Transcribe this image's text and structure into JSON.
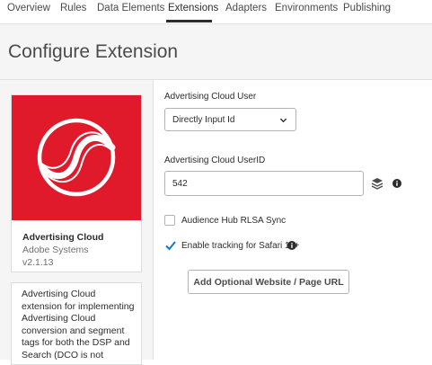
{
  "nav": {
    "tabs": [
      "Overview",
      "Rules",
      "Data Elements",
      "Extensions",
      "Adapters",
      "Environments",
      "Publishing"
    ],
    "active_tab": "Extensions"
  },
  "page": {
    "title": "Configure Extension"
  },
  "extension": {
    "name": "Advertising Cloud",
    "vendor": "Adobe Systems",
    "version": "v2.1.13",
    "description": "Advertising Cloud extension for implementing Advertising Cloud conversion and segment tags for both the DSP and Search (DCO is not",
    "logo_color": "#e01a2b"
  },
  "form": {
    "user_label": "Advertising Cloud User",
    "user_select_value": "Directly Input Id",
    "userid_label": "Advertising Cloud UserID",
    "userid_value": "542",
    "audience_hub_label": "Audience Hub RLSA Sync",
    "audience_hub_checked": false,
    "safari_label": "Enable tracking for Safari 11+",
    "safari_checked": true,
    "add_url_button": "Add Optional Website / Page URL"
  },
  "icons": {
    "select_chevron": "chevron-down-icon",
    "data_element": "data-element-icon",
    "info": "info-icon",
    "checkmark": "checkmark-icon"
  },
  "colors": {
    "accent": "#e01a2b",
    "check": "#1473e6"
  }
}
